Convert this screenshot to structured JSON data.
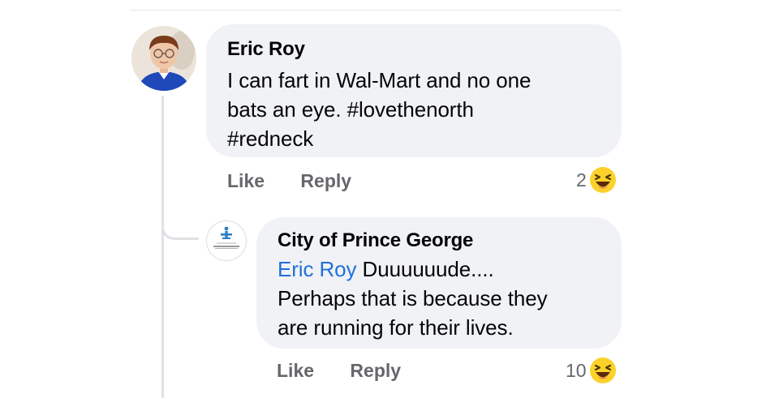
{
  "comment": {
    "author": "Eric Roy",
    "avatar_icon": "profile-photo",
    "text": "I can fart in Wal-Mart and no one bats an eye. #lovethenorth #redneck",
    "text_lines": [
      "I can fart in Wal-Mart and no one",
      "bats an eye. #lovethenorth",
      "#redneck"
    ],
    "actions": {
      "like": "Like",
      "reply": "Reply"
    },
    "reaction": {
      "count": "2",
      "icon": "laughing-emoji-icon"
    }
  },
  "reply": {
    "author": "City of Prince George",
    "avatar_icon": "city-logo-icon",
    "mention": "Eric Roy",
    "text_lines": [
      " Duuuuuude....",
      "Perhaps that is because they",
      "are running for their lives."
    ],
    "actions": {
      "like": "Like",
      "reply": "Reply"
    },
    "reaction": {
      "count": "10",
      "icon": "laughing-emoji-icon"
    }
  },
  "colors": {
    "bubble": "#f0f2f5",
    "mention": "#216fdb",
    "muted": "#65676b",
    "text": "#050505"
  }
}
